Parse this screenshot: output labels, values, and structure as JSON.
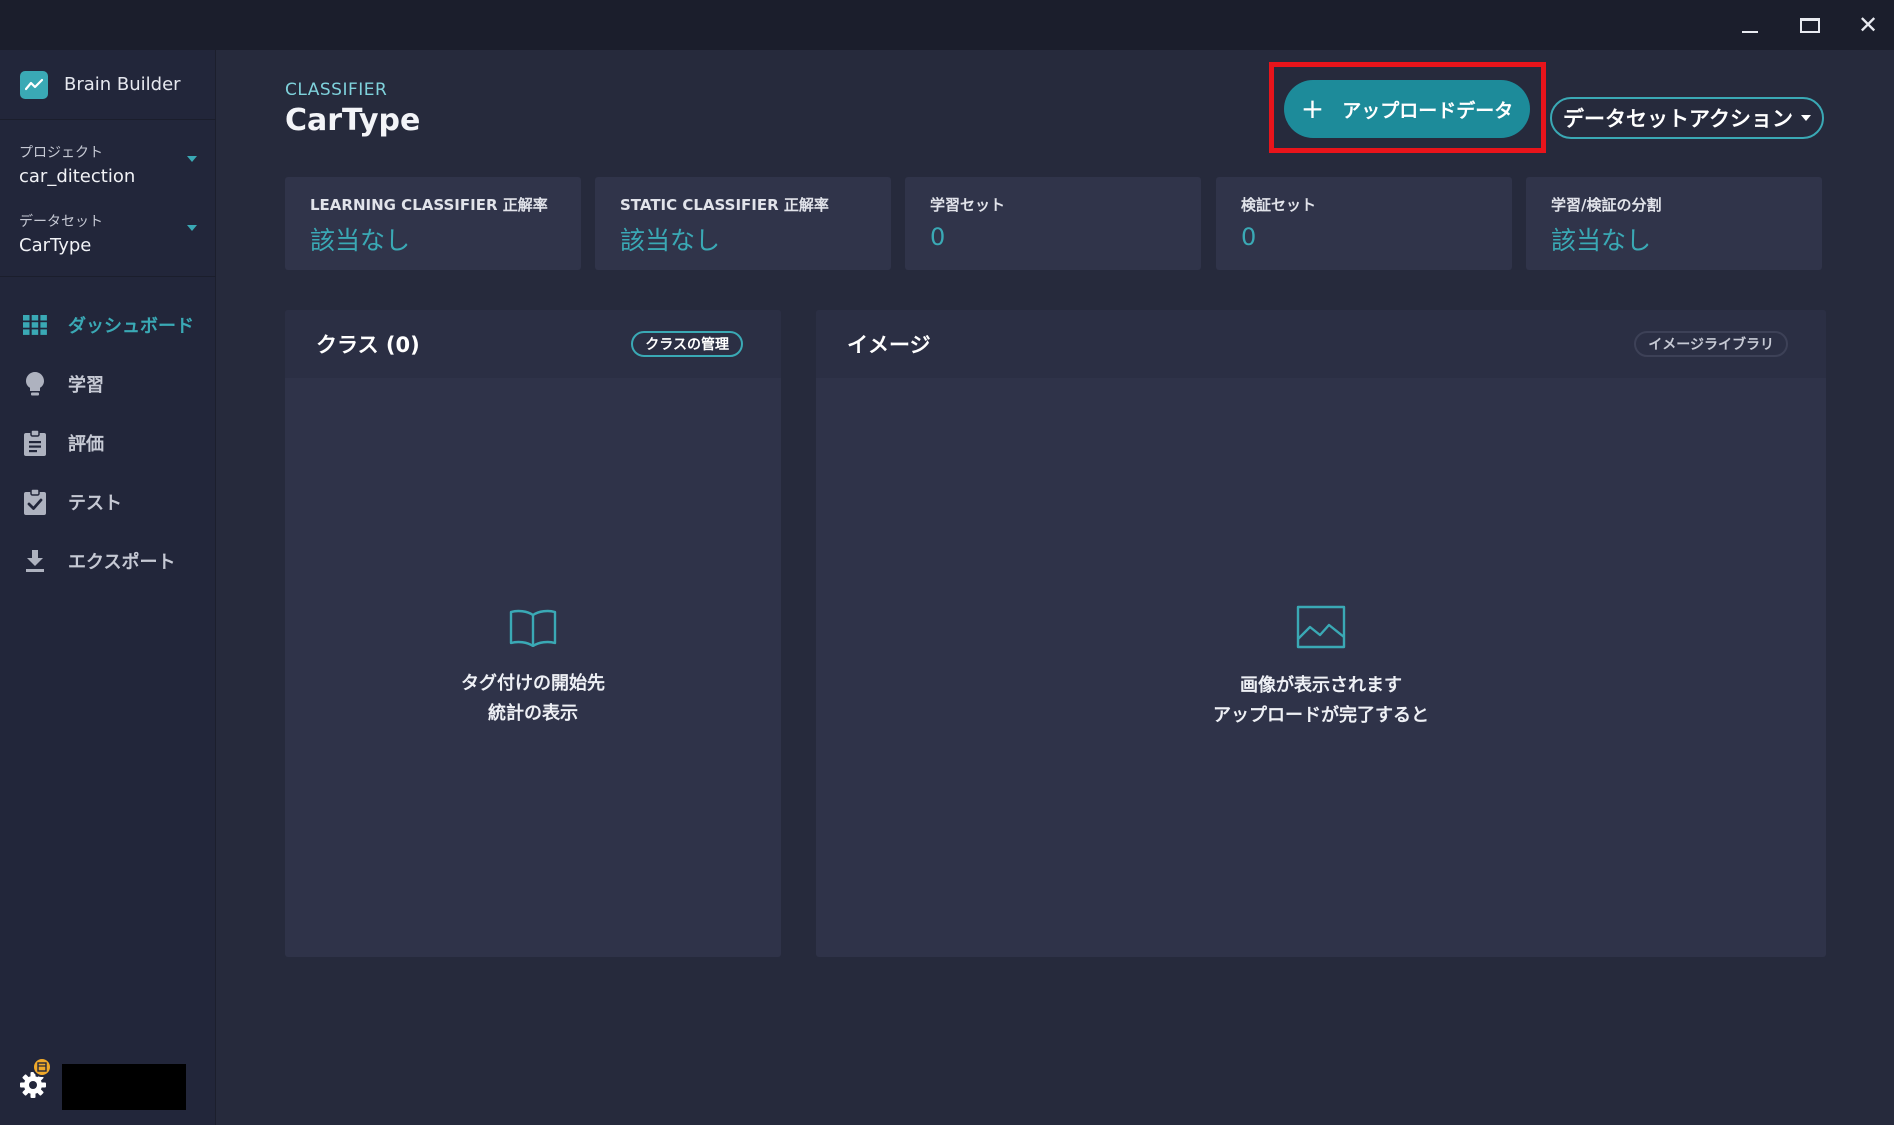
{
  "window": {
    "minimize_icon": "minimize-icon",
    "maximize_icon": "maximize-icon",
    "close_glyph": "✕"
  },
  "sidebar": {
    "brand": "Brain Builder",
    "project": {
      "label": "プロジェクト",
      "value": "car_ditection"
    },
    "dataset": {
      "label": "データセット",
      "value": "CarType"
    },
    "nav": [
      {
        "label": "ダッシュボード",
        "icon": "grid-icon",
        "active": true
      },
      {
        "label": "学習",
        "icon": "lightbulb-icon",
        "active": false
      },
      {
        "label": "評価",
        "icon": "clipboard-icon",
        "active": false
      },
      {
        "label": "テスト",
        "icon": "clipboard-check-icon",
        "active": false
      },
      {
        "label": "エクスポート",
        "icon": "download-icon",
        "active": false
      }
    ]
  },
  "header": {
    "crumb": "CLASSIFIER",
    "title": "CarType",
    "upload_plus": "+",
    "upload_label": "アップロードデータ",
    "dataset_action_label": "データセットアクション"
  },
  "stats": [
    {
      "label": "LEARNING CLASSIFIER 正解率",
      "value": "該当なし"
    },
    {
      "label": "STATIC CLASSIFIER 正解率",
      "value": "該当なし"
    },
    {
      "label": "学習セット",
      "value": "0"
    },
    {
      "label": "検証セット",
      "value": "0"
    },
    {
      "label": "学習/検証の分割",
      "value": "該当なし"
    }
  ],
  "classes_panel": {
    "title": "クラス (0)",
    "action": "クラスの管理",
    "empty_line1": "タグ付けの開始先",
    "empty_line2": "統計の表示"
  },
  "images_panel": {
    "title": "イメージ",
    "action": "イメージライブラリ",
    "empty_line1": "画像が表示されます",
    "empty_line2": "アップロードが完了すると"
  },
  "colors": {
    "accent": "#3aa9b5",
    "upload_button": "#1d8b9a",
    "highlight": "#e8141b",
    "background": "#262a3c",
    "notification": "#f0a92a"
  }
}
